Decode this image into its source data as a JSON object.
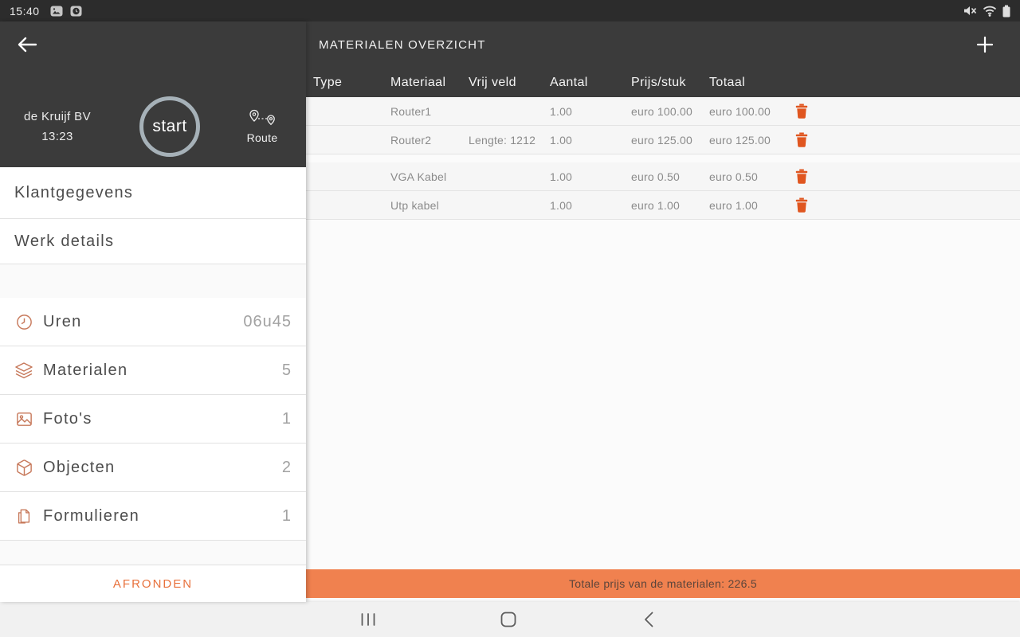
{
  "status_bar": {
    "time": "15:40"
  },
  "header": {
    "title": "MATERIALEN OVERZICHT"
  },
  "job_panel": {
    "company": "de Kruijf BV",
    "time": "13:23",
    "start_button": "start",
    "route_label": "Route"
  },
  "sidebar": {
    "nav_items": [
      {
        "label": "Klantgegevens"
      },
      {
        "label": "Werk details"
      }
    ],
    "detail_items": [
      {
        "icon": "clock-icon",
        "label": "Uren",
        "value": "06u45"
      },
      {
        "icon": "layers-icon",
        "label": "Materialen",
        "value": "5"
      },
      {
        "icon": "photo-icon",
        "label": "Foto's",
        "value": "1"
      },
      {
        "icon": "cube-icon",
        "label": "Objecten",
        "value": "2"
      },
      {
        "icon": "document-icon",
        "label": "Formulieren",
        "value": "1"
      }
    ],
    "finish_button_label": "AFRONDEN"
  },
  "table": {
    "columns": [
      "Type",
      "Materiaal",
      "Vrij veld",
      "Aantal",
      "Prijs/stuk",
      "Totaal"
    ],
    "groups": [
      {
        "rows": [
          {
            "type": "",
            "materiaal": "Router1",
            "vrij_veld": "",
            "aantal": "1.00",
            "prijs_stuk": "euro 100.00",
            "totaal": "euro 100.00"
          },
          {
            "type": "",
            "materiaal": "Router2",
            "vrij_veld": "Lengte: 1212",
            "aantal": "1.00",
            "prijs_stuk": "euro 125.00",
            "totaal": "euro 125.00"
          }
        ]
      },
      {
        "rows": [
          {
            "type": "",
            "materiaal": "VGA Kabel",
            "vrij_veld": "",
            "aantal": "1.00",
            "prijs_stuk": "euro 0.50",
            "totaal": "euro 0.50"
          },
          {
            "type": "",
            "materiaal": "Utp kabel",
            "vrij_veld": "",
            "aantal": "1.00",
            "prijs_stuk": "euro 1.00",
            "totaal": "euro 1.00"
          }
        ]
      }
    ]
  },
  "totals": {
    "label": "Totale prijs van de materialen: 226.5"
  },
  "colors": {
    "accent_orange": "#e05620",
    "total_bar_orange": "#f0814f",
    "dark_background": "#3b3b3b",
    "sidebar_icon_copper": "#c7795b"
  }
}
